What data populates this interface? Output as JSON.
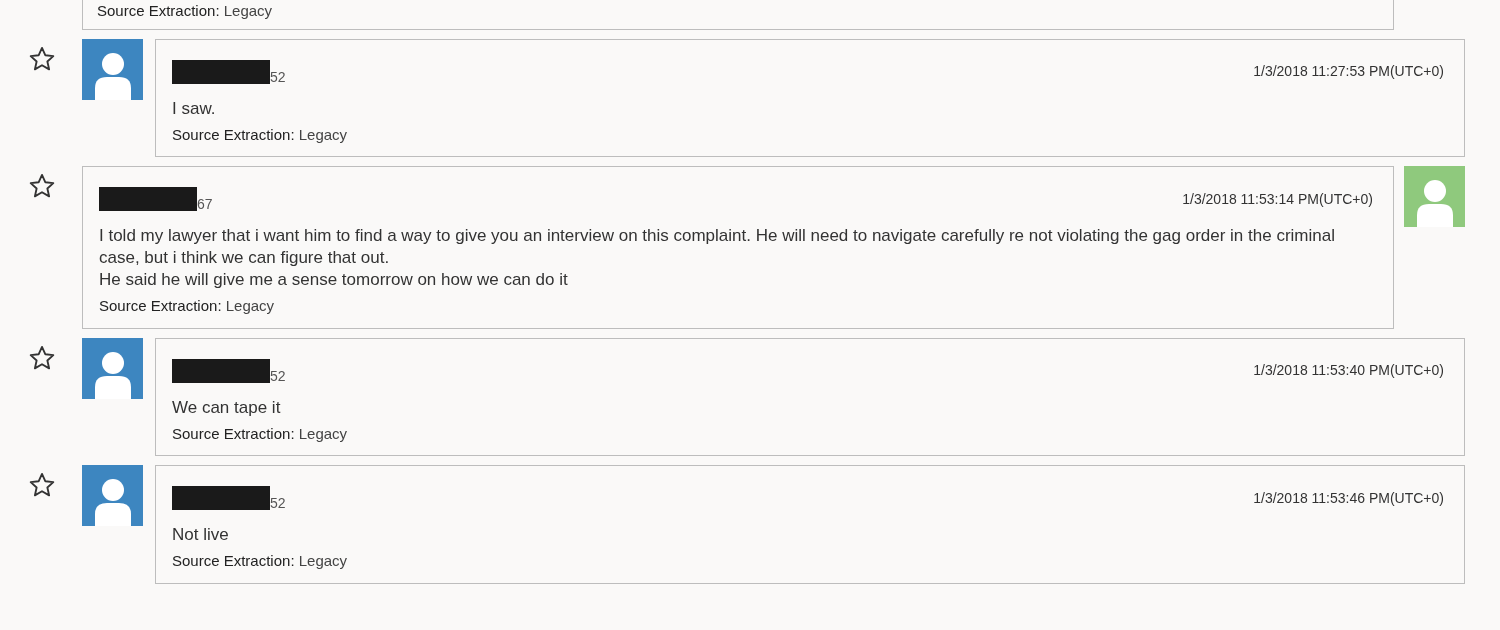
{
  "messages": [
    {
      "kind": "continued",
      "source": {
        "label": "Source Extraction:",
        "value": "Legacy"
      }
    },
    {
      "kind": "incoming",
      "starred": false,
      "sender": {
        "redacted": true,
        "suffix": "52"
      },
      "time": "1/3/2018 11:27:53 PM(UTC+0)",
      "text": [
        "I saw."
      ],
      "source": {
        "label": "Source Extraction:",
        "value": "Legacy"
      }
    },
    {
      "kind": "outgoing",
      "starred": false,
      "sender": {
        "redacted": true,
        "suffix": "67"
      },
      "time": "1/3/2018 11:53:14 PM(UTC+0)",
      "text": [
        "I told my lawyer that i want him to find a way to give you an interview on this complaint. He will need to navigate carefully re not violating the gag order in the criminal case, but i think we can figure that out.",
        "He said he will give me a sense tomorrow on how we can do it"
      ],
      "source": {
        "label": "Source Extraction:",
        "value": "Legacy"
      }
    },
    {
      "kind": "incoming",
      "starred": false,
      "sender": {
        "redacted": true,
        "suffix": "52"
      },
      "time": "1/3/2018 11:53:40 PM(UTC+0)",
      "text": [
        "We can tape it"
      ],
      "source": {
        "label": "Source Extraction:",
        "value": "Legacy"
      }
    },
    {
      "kind": "incoming",
      "starred": false,
      "sender": {
        "redacted": true,
        "suffix": "52"
      },
      "time": "1/3/2018 11:53:46 PM(UTC+0)",
      "text": [
        "Not live"
      ],
      "source": {
        "label": "Source Extraction:",
        "value": "Legacy"
      }
    }
  ]
}
